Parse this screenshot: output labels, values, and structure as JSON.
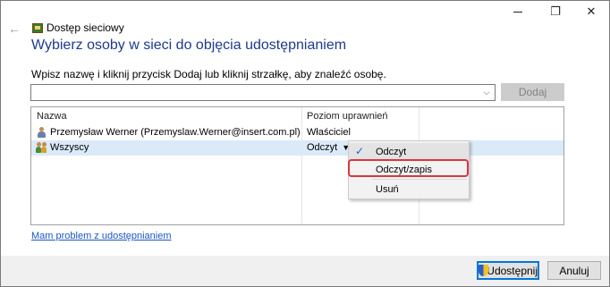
{
  "window": {
    "title": "Dostęp sieciowy",
    "controls": {
      "minimize": "",
      "maximize": "❐",
      "close": "✕"
    }
  },
  "nav": {
    "back_icon": "←"
  },
  "page": {
    "heading": "Wybierz osoby w sieci do objęcia udostępnianiem",
    "instruction": "Wpisz nazwę i kliknij przycisk Dodaj lub kliknij strzałkę, aby znaleźć osobę.",
    "add_button": "Dodaj",
    "combo_arrow": "⌵"
  },
  "list": {
    "columns": [
      "Nazwa",
      "Poziom uprawnień"
    ],
    "rows": [
      {
        "name": "Przemysław Werner (Przemyslaw.Werner@insert.com.pl)",
        "permission": "Właściciel",
        "icon": "user-icon"
      },
      {
        "name": "Wszyscy",
        "permission": "Odczyt",
        "icon": "group-icon",
        "selected": true
      }
    ],
    "dropdown_arrow": "▼"
  },
  "context_menu": {
    "items": [
      {
        "label": "Odczyt",
        "checked": true,
        "check_glyph": "✓"
      },
      {
        "label": "Odczyt/zapis",
        "highlighted_box": true
      },
      {
        "label": "Usuń"
      }
    ]
  },
  "help_link": "Mam problem z udostępnianiem",
  "footer": {
    "share_button": "Udostępnij",
    "cancel_button": "Anuluj"
  },
  "colors": {
    "heading": "#1e3a8c",
    "link": "#1a56c8",
    "selection": "#dbeaf9",
    "annotation": "#d9363e",
    "check": "#1464d4"
  }
}
